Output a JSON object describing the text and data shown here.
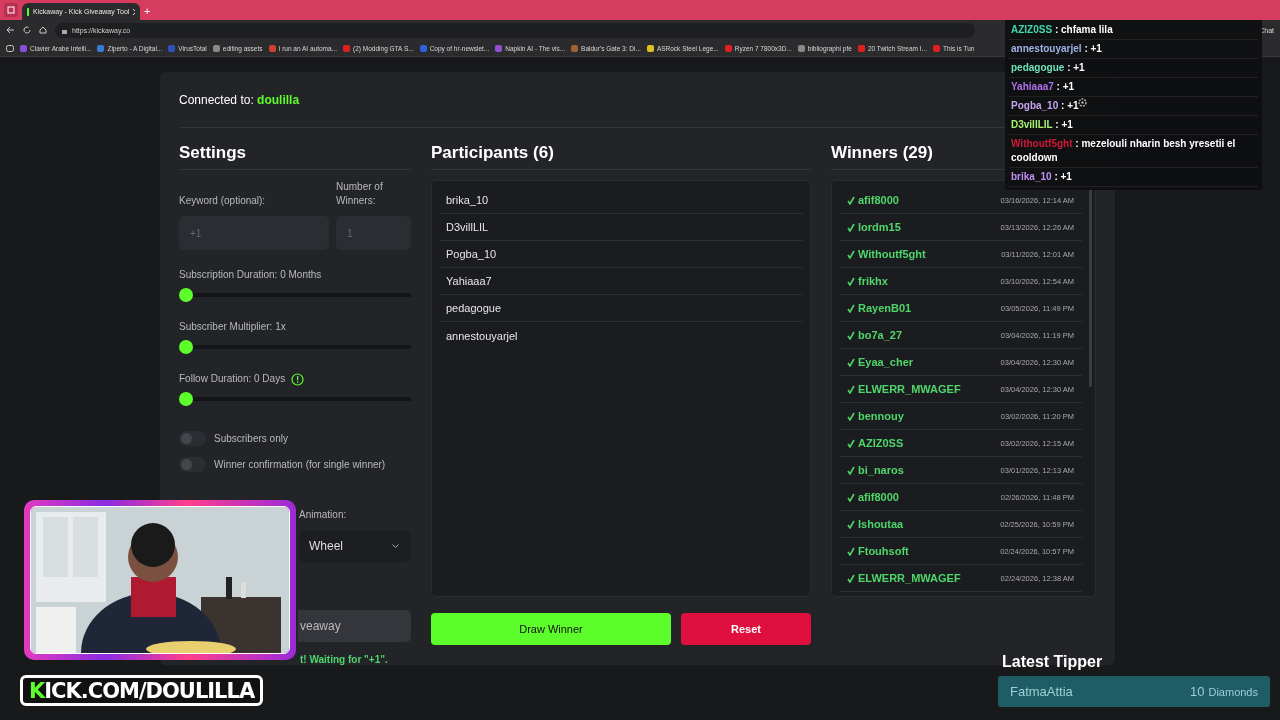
{
  "browser": {
    "tab_title": "Kickaway - Kick Giveaway Tool",
    "new_tab": "+",
    "url": "https://kickaway.co",
    "chat_button": "Chat",
    "bookmarks": [
      "Clavier Arabe Intelli...",
      "Ziperto - A Digital...",
      "VirusTotal",
      "editing assets",
      "I run an AI automa...",
      "(2) Modding GTA S...",
      "Copy of hr-newslet...",
      "Napkin AI - The vis...",
      "Baldur's Gate 3: Di...",
      "ASRock Steel Lege...",
      "Ryzen 7 7800x3D...",
      "bibliographi pfe",
      "20 Twitch Stream I...",
      "This is Tun"
    ]
  },
  "connected": {
    "label": "Connected to:",
    "channel": "doulilla"
  },
  "settings": {
    "title": "Settings",
    "keyword": {
      "label": "Keyword (optional):",
      "placeholder": "+1"
    },
    "winners_count": {
      "label": "Number of Winners:",
      "placeholder": "1"
    },
    "sliders": [
      {
        "label": "Subscription Duration: 0 Months",
        "level": 0,
        "info": false
      },
      {
        "label": "Subscriber Multiplier: 1x",
        "level": 0,
        "info": false
      },
      {
        "label": "Follow Duration:  0  Days",
        "level": 0,
        "info": true
      }
    ],
    "toggles": [
      {
        "label": "Subscribers only",
        "on": false
      },
      {
        "label": "Winner confirmation (for single winner)",
        "on": false
      }
    ],
    "animation": {
      "label": "Animation:",
      "value": "Wheel"
    },
    "start_button": "veaway",
    "status": "t! Waiting for \"+1\"."
  },
  "participants": {
    "title": "Participants (6)",
    "names": [
      "brika_10",
      "D3villLIL",
      "Pogba_10",
      "Yahiaaa7",
      "pedagogue",
      "annestouyarjel"
    ]
  },
  "actions": {
    "draw": "Draw Winner",
    "reset": "Reset"
  },
  "winners": {
    "title": "Winners (29)",
    "rows": [
      {
        "name": "afif8000",
        "date": "03/16/2026, 12:14 AM"
      },
      {
        "name": "lordm15",
        "date": "03/13/2026, 12:26 AM"
      },
      {
        "name": "Withoutf5ght",
        "date": "03/11/2026, 12:01 AM"
      },
      {
        "name": "frikhx",
        "date": "03/10/2026, 12:54 AM"
      },
      {
        "name": "RayenB01",
        "date": "03/05/2026, 11:49 PM"
      },
      {
        "name": "bo7a_27",
        "date": "03/04/2026, 11:19 PM"
      },
      {
        "name": "Eyaa_cher",
        "date": "03/04/2026, 12:30 AM"
      },
      {
        "name": "ELWERR_MWAGEF",
        "date": "03/04/2026, 12:30 AM"
      },
      {
        "name": "bennouy",
        "date": "03/02/2026, 11:20 PM"
      },
      {
        "name": "AZIZ0SS",
        "date": "03/02/2026, 12:15 AM"
      },
      {
        "name": "bi_naros",
        "date": "03/01/2026, 12:13 AM"
      },
      {
        "name": "afif8000",
        "date": "02/26/2026, 11:48 PM"
      },
      {
        "name": "Ishoutaa",
        "date": "02/25/2026, 10:59 PM"
      },
      {
        "name": "Ftouhsoft",
        "date": "02/24/2026, 10:57 PM"
      },
      {
        "name": "ELWERR_MWAGEF",
        "date": "02/24/2026, 12:38 AM"
      }
    ]
  },
  "chat": [
    {
      "user": "AZIZ0SS",
      "color": "#3fd9a8",
      "text": ": chfama lila"
    },
    {
      "user": "annestouyarjel",
      "color": "#9fb4e8",
      "text": ": +1"
    },
    {
      "user": "pedagogue",
      "color": "#6fe3b8",
      "text": ": +1"
    },
    {
      "user": "Yahiaaa7",
      "color": "#b070e8",
      "text": ": +1"
    },
    {
      "user": "Pogba_10",
      "color": "#c7a0f0",
      "text": ": +1"
    },
    {
      "user": "D3villLIL",
      "color": "#a8f070",
      "text": ": +1"
    },
    {
      "user": "Withoutf5ght",
      "color": "#d01838",
      "text": ": mezelouli nharin besh yresetii el cooldown"
    },
    {
      "user": "brika_10",
      "color": "#c090f0",
      "text": ": +1"
    }
  ],
  "stream_logo": {
    "lead": "K",
    "rest": "ICK.COM/DOULILLA"
  },
  "latest_tipper": {
    "title": "Latest Tipper",
    "name": "FatmaAttia",
    "amount": "10",
    "unit": "Diamonds"
  }
}
